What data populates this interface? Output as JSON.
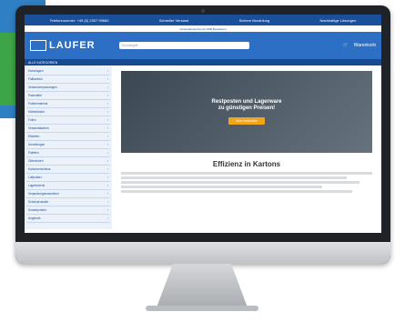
{
  "topbar": {
    "items": [
      "Telefonnummer: +49 (0) 2307 99660",
      "Schneller Versand",
      "Sichere Bezahlung",
      "Nachhaltige Lösungen"
    ]
  },
  "subbar": {
    "text": "Versandkostenfrei ab 199€ Bestellwert"
  },
  "header": {
    "logo": "LAUFER",
    "search_placeholder": "Suchbegriff...",
    "cart_label": "Warenkorb"
  },
  "nav": {
    "label": "ALLE KATEGORIEN"
  },
  "sidebar": {
    "items": [
      "Kartonagen",
      "Faltkartons",
      "Versandverpackungen",
      "Packmittel",
      "Polstermaterial",
      "Klebebänder",
      "Folien",
      "Versandtaschen",
      "Etiketten",
      "Umreifungen",
      "Paletten",
      "Gitterboxen",
      "Kartonverschluss",
      "Luftpolster",
      "Lagertechnik",
      "Verpackungsmaschinen",
      "Schutzprodukte",
      "Sonderposten",
      "Angebote"
    ]
  },
  "hero": {
    "title_line1": "Restposten und Lagerware",
    "title_line2": "zu günstigen Preisen!",
    "button": "Jetzt entdecken"
  },
  "main": {
    "heading": "Effizienz in Kartons"
  }
}
